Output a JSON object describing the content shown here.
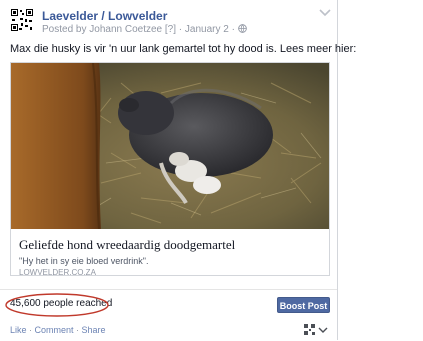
{
  "post": {
    "page_name": "Laevelder / Lowvelder",
    "posted_by_prefix": "Posted by",
    "author": "Johann Coetzee",
    "author_suffix": "[?]",
    "separator": "·",
    "date": "January 2",
    "date_suffix": "·",
    "text": "Max die husky is vir 'n uur lank gemartel tot hy dood is. Lees meer hier:"
  },
  "link": {
    "title": "Geliefde hond wreedaardig doodgemartel",
    "description": "\"Hy het in sy eie bloed verdrink\".",
    "domain": "LOWVELDER.CO.ZA"
  },
  "stats": {
    "reach": "45,600 people reached",
    "boost_label": "Boost Post"
  },
  "actions": {
    "like": "Like",
    "dot1": " · ",
    "comment": "Comment",
    "dot2": " · ",
    "share": "Share"
  },
  "colors": {
    "link_blue": "#3b5998",
    "boost_button": "#4e69a2",
    "reach_oval": "#c0392b"
  },
  "icons": [
    "qr-code-icon",
    "chevron-down-icon",
    "globe-icon",
    "share-audience-icon"
  ]
}
